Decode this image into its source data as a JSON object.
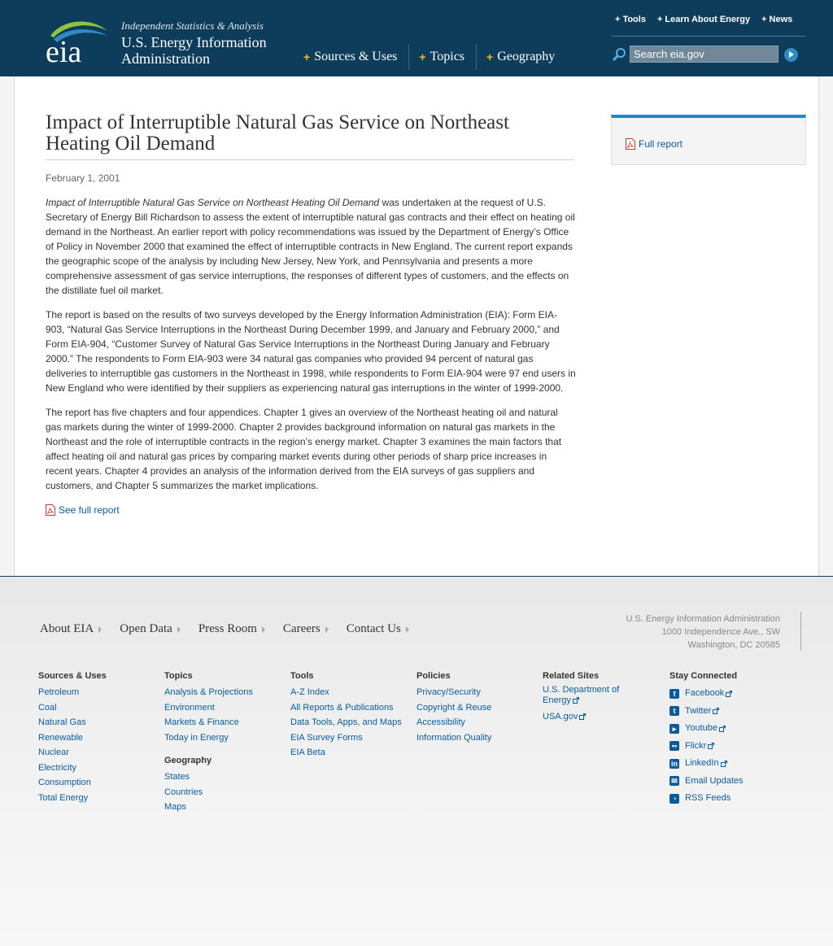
{
  "header": {
    "tagline": "Independent Statistics & Analysis",
    "org_line1": "U.S. Energy Information",
    "org_line2": "Administration",
    "logo_text": "eia",
    "main_nav": [
      "Sources & Uses",
      "Topics",
      "Geography"
    ],
    "util_nav": [
      "Tools",
      "Learn About Energy",
      "News"
    ],
    "search_placeholder": "Search eia.gov"
  },
  "article": {
    "title": "Impact of Interruptible Natural Gas Service on Northeast Heating Oil Demand",
    "date": "February 1, 2001",
    "p1_italic": "Impact of Interruptible Natural Gas Service on Northeast Heating Oil Demand",
    "p1_rest": " was undertaken at the request of U.S. Secretary of Energy Bill Richardson to assess the extent of interruptible natural gas contracts and their effect on heating oil demand in the Northeast. An earlier report with policy recommendations was issued by the Department of Energy’s Office of Policy in November 2000 that examined the effect of interruptible contracts in New England. The current report expands the geographic scope of the analysis by including New Jersey, New York, and Pennsylvania and presents a more comprehensive assessment of gas service interruptions, the responses of different types of customers, and the effects on the distillate fuel oil market.",
    "p2": "The report is based on the results of two surveys developed by the Energy Information Administration (EIA): Form EIA-903, “Natural Gas Service Interruptions in the Northeast During December 1999, and January and February 2000,” and Form EIA-904, “Customer Survey of Natural Gas Service Interruptions in the Northeast During January and February 2000.” The respondents to Form EIA-903 were 34 natural gas companies who provided 94 percent of natural gas deliveries to interruptible gas customers in the Northeast in 1998, while respondents to Form EIA-904 were 97 end users in New England who were identified by their suppliers as experiencing natural gas interruptions in the winter of 1999-2000.",
    "p3": "The report has five chapters and four appendices. Chapter 1 gives an overview of the Northeast heating oil and natural gas markets during the winter of 1999-2000. Chapter 2 provides background information on natural gas markets in the Northeast and the role of interruptible contracts in the region’s energy market. Chapter 3 examines the main factors that affect heating oil and natural gas prices by comparing market events during other periods of sharp price increases in recent years. Chapter 4 provides an analysis of the information derived from the EIA surveys of gas suppliers and customers, and Chapter 5 summarizes the market implications.",
    "full_report_link": "See full report"
  },
  "sidebar": {
    "full_report_link": "Full report"
  },
  "footer": {
    "nav": [
      "About EIA",
      "Open Data",
      "Press Room",
      "Careers",
      "Contact Us"
    ],
    "address": [
      "U.S. Energy Information Administration",
      "1000 Independence Ave., SW",
      "Washington, DC 20585"
    ],
    "columns": {
      "sources": {
        "heading": "Sources & Uses",
        "links": [
          "Petroleum",
          "Coal",
          "Natural Gas",
          "Renewable",
          "Nuclear",
          "Electricity",
          "Consumption",
          "Total Energy"
        ]
      },
      "topics": {
        "heading": "Topics",
        "links": [
          "Analysis & Projections",
          "Environment",
          "Markets & Finance",
          "Today in Energy"
        ]
      },
      "geography": {
        "heading": "Geography",
        "links": [
          "States",
          "Countries",
          "Maps"
        ]
      },
      "tools": {
        "heading": "Tools",
        "links": [
          "A-Z Index",
          "All Reports & Publications",
          "Data Tools, Apps, and Maps",
          "EIA Survey Forms",
          "EIA Beta"
        ]
      },
      "policies": {
        "heading": "Policies",
        "links": [
          "Privacy/Security",
          "Copyright & Reuse",
          "Accessibility",
          "Information Quality"
        ]
      },
      "related": {
        "heading": "Related Sites",
        "links": [
          "U.S. Department of Energy",
          "USA.gov"
        ]
      },
      "social": {
        "heading": "Stay Connected",
        "links": [
          "Facebook",
          "Twitter",
          "Youtube",
          "Flickr",
          "LinkedIn",
          "Email Updates",
          "RSS Feeds"
        ]
      }
    }
  },
  "colors": {
    "header_bg": "#0e3c5b",
    "accent_yellow": "#f6c31b",
    "link_blue": "#0b5b9c",
    "sidebar_accent": "#2089c7"
  }
}
